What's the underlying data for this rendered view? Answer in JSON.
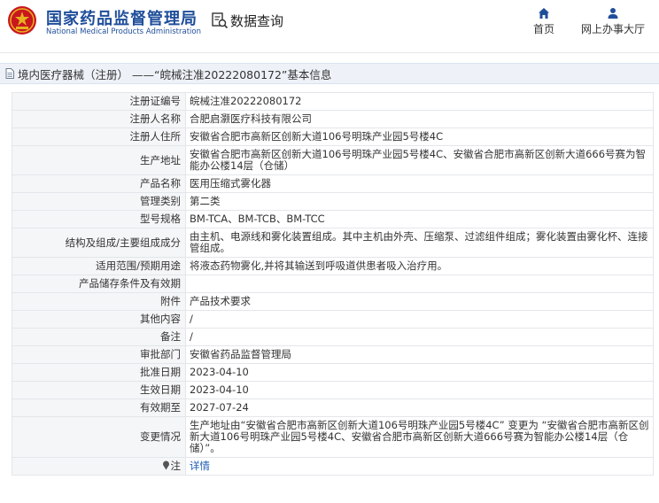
{
  "header": {
    "brand_cn": "国家药品监督管理局",
    "brand_en": "National Medical Products Administration",
    "query_label": "数据查询",
    "nav": [
      {
        "label": "首页",
        "icon": "home-icon"
      },
      {
        "label": "网上办事大厅",
        "icon": "user-icon"
      }
    ],
    "colors": {
      "brand": "#1f4e9a",
      "logo_red": "#c9171e",
      "logo_gold": "#e7b21f",
      "nav_icon": "#1f4e9a"
    }
  },
  "title_bar": {
    "text": "境内医疗器械（注册） ——“皖械注准20222080172”基本信息",
    "icon": "document-icon"
  },
  "rows": [
    {
      "label": "注册证编号",
      "value": "皖械注准20222080172"
    },
    {
      "label": "注册人名称",
      "value": "合肥启灏医疗科技有限公司"
    },
    {
      "label": "注册人住所",
      "value": "安徽省合肥市高新区创新大道106号明珠产业园5号楼4C"
    },
    {
      "label": "生产地址",
      "value": "安徽省合肥市高新区创新大道106号明珠产业园5号楼4C、安徽省合肥市高新区创新大道666号赛为智能办公楼14层（仓储）"
    },
    {
      "label": "产品名称",
      "value": "医用压缩式雾化器"
    },
    {
      "label": "管理类别",
      "value": "第二类"
    },
    {
      "label": "型号规格",
      "value": "BM-TCA、BM-TCB、BM-TCC"
    },
    {
      "label": "结构及组成/主要组成成分",
      "value": "由主机、电源线和雾化装置组成。其中主机由外壳、压缩泵、过滤组件组成；雾化装置由雾化杯、连接管组成。"
    },
    {
      "label": "适用范围/预期用途",
      "value": "将液态药物雾化,并将其输送到呼吸道供患者吸入治疗用。"
    },
    {
      "label": "产品储存条件及有效期",
      "value": ""
    },
    {
      "label": "附件",
      "value": "产品技术要求"
    },
    {
      "label": "其他内容",
      "value": "/"
    },
    {
      "label": "备注",
      "value": "/"
    },
    {
      "label": "审批部门",
      "value": "安徽省药品监督管理局"
    },
    {
      "label": "批准日期",
      "value": "2023-04-10"
    },
    {
      "label": "生效日期",
      "value": "2023-04-10"
    },
    {
      "label": "有效期至",
      "value": "2027-07-24"
    },
    {
      "label": "变更情况",
      "value": "生产地址由“安徽省合肥市高新区创新大道106号明珠产业园5号楼4C” 变更为 “安徽省合肥市高新区创新大道106号明珠产业园5号楼4C、安徽省合肥市高新区创新大道666号赛为智能办公楼14层（仓储）”。"
    }
  ],
  "note_row": {
    "label": "注",
    "link": "详情",
    "icon": "pin-icon"
  }
}
